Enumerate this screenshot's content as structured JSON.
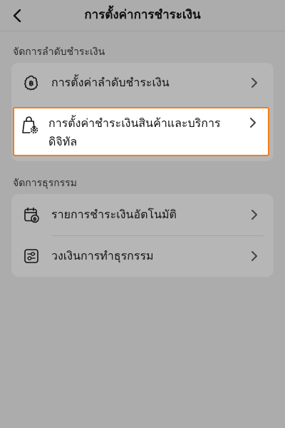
{
  "header": {
    "title": "การตั้งค่าการชำระเงิน",
    "back_icon": "chevron-left-icon"
  },
  "sections": [
    {
      "title": "จัดการลำดับชำระเงิน",
      "items": [
        {
          "label": "การตั้งค่าลำดับชำระเงิน",
          "icon": "baht-gear-icon"
        },
        {
          "label_line1": "การตั้งค่าชำระเงินสินค้าและบริการ",
          "label_line2": "ดิจิทัล",
          "icon": "bag-gear-icon",
          "highlighted": true
        }
      ]
    },
    {
      "title": "จัดการธุรกรรม",
      "items": [
        {
          "label": "รายการชำระเงินอัตโนมัติ",
          "icon": "calendar-baht-icon"
        },
        {
          "label": "วงเงินการทำธุรกรรม",
          "icon": "sliders-icon"
        }
      ]
    }
  ],
  "colors": {
    "background": "#acacac",
    "card": "#b6b6b6",
    "highlight_border": "#f07d1a"
  }
}
